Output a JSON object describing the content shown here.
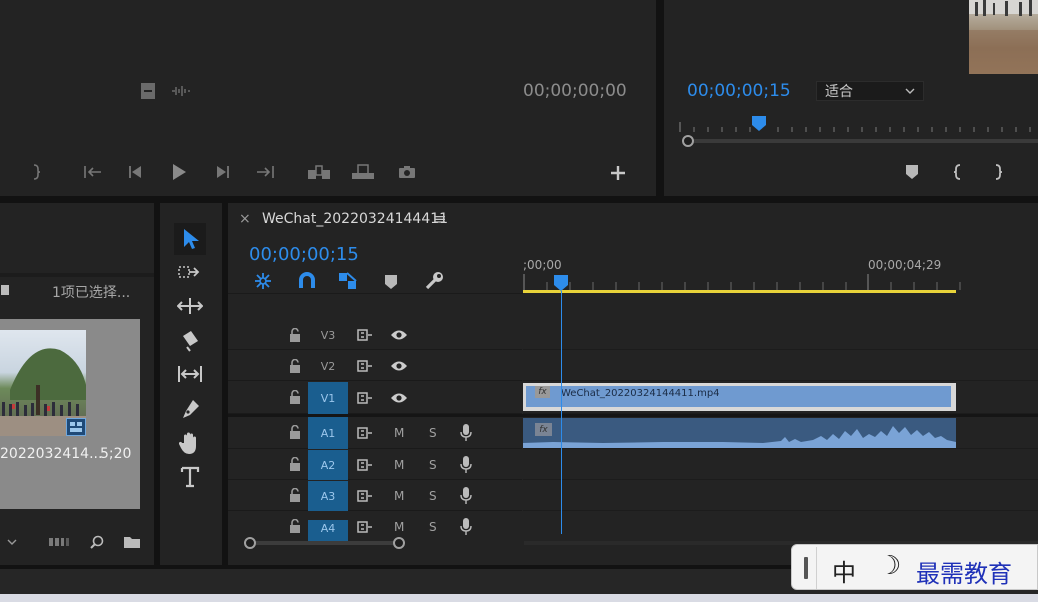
{
  "source_monitor": {
    "timecode": "00;00;00;00"
  },
  "program_monitor": {
    "timecode": "00;00;00;15",
    "fit_dropdown": {
      "selected": "适合"
    }
  },
  "project_panel": {
    "selection_status": "1项已选择...",
    "clip": {
      "name": "2022032414...",
      "duration": "5;20"
    }
  },
  "timeline": {
    "tab_title": "WeChat_20220324144411",
    "tab_menu_glyph": "≡",
    "close_glyph": "×",
    "timecode": "00;00;00;15",
    "ruler": {
      "start_label": ";00;00",
      "end_label": "00;00;04;29"
    },
    "tracks_video": [
      {
        "label": "V3",
        "active": false
      },
      {
        "label": "V2",
        "active": false
      },
      {
        "label": "V1",
        "active": true
      }
    ],
    "tracks_audio": [
      {
        "label": "A1",
        "active": true
      },
      {
        "label": "A2",
        "active": true
      },
      {
        "label": "A3",
        "active": true
      },
      {
        "label": "A4",
        "active": true
      }
    ],
    "mute_label": "M",
    "solo_label": "S",
    "video_clip": {
      "fx": "fx",
      "name": "WeChat_20220324144411.mp4"
    },
    "audio_clip": {
      "fx": "fx"
    }
  },
  "ime_toolbar": {
    "mode": "中",
    "moon": "☽",
    "brand": "最需教育"
  },
  "colors": {
    "accent": "#2d8ceb",
    "video_clip": "#6f9ad0",
    "audio_clip": "#3a5a80",
    "work_area": "#e8d33a"
  }
}
